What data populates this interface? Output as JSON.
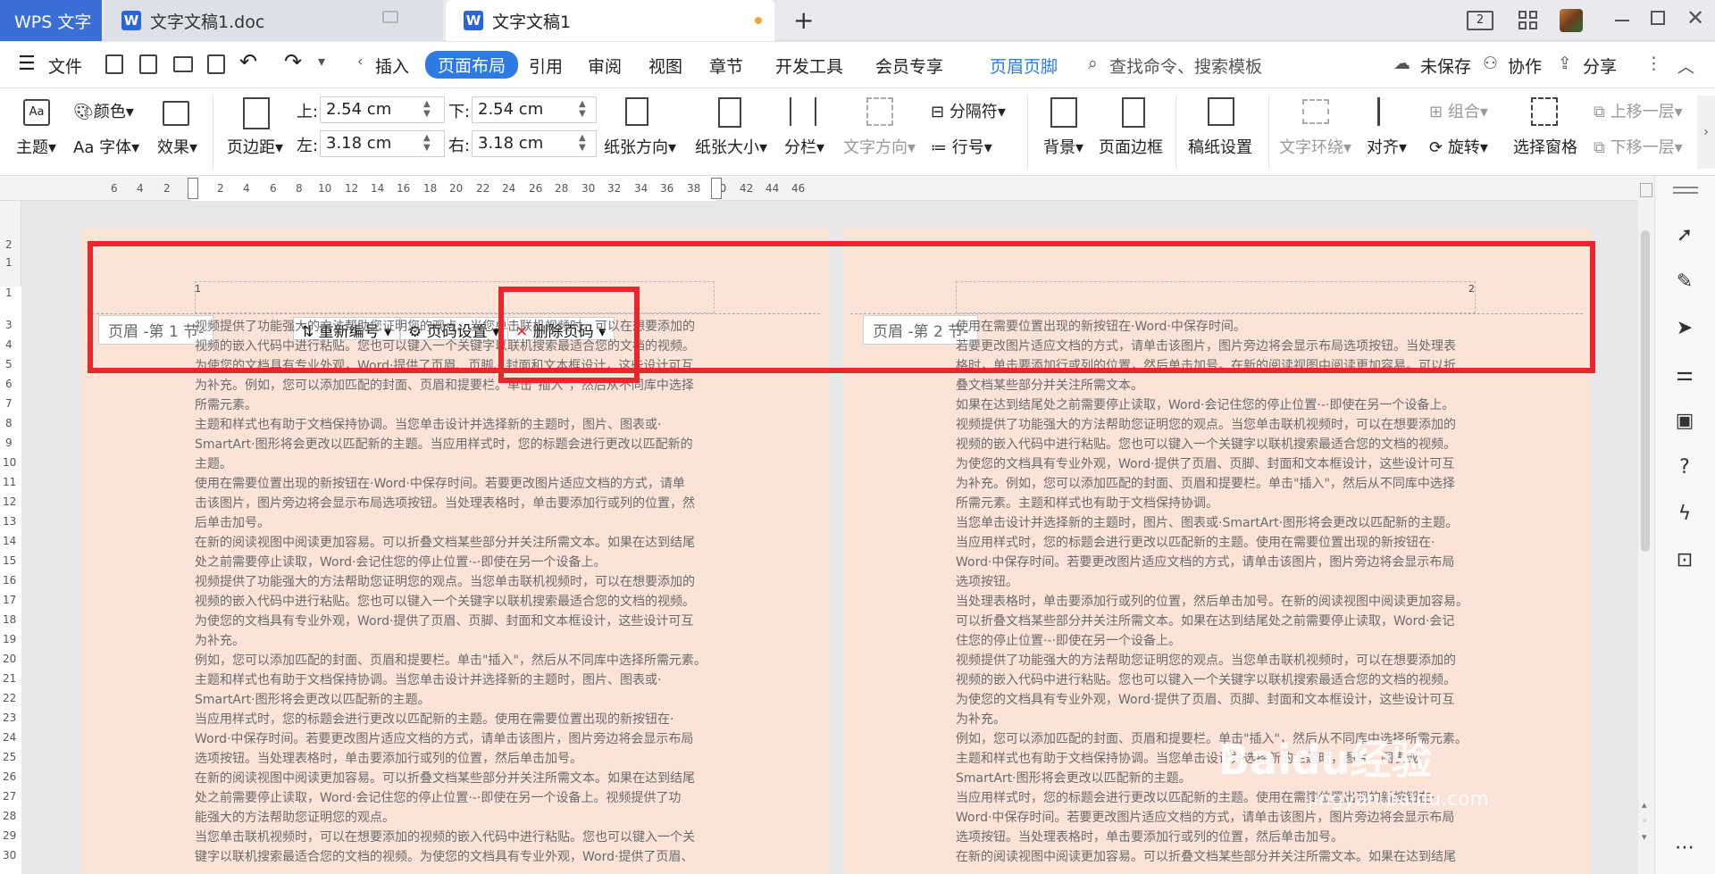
{
  "tabs": {
    "app": "WPS 文字",
    "doc1": "文字文稿1.doc",
    "doc2": "文字文稿1",
    "new_tab": "+",
    "badge": "2"
  },
  "menu": {
    "file": "文件",
    "items": [
      "插入",
      "页面布局",
      "引用",
      "审阅",
      "视图",
      "章节",
      "开发工具",
      "会员专享",
      "页眉页脚"
    ],
    "search": "查找命令、搜索模板",
    "unsaved": "未保存",
    "collab": "协作",
    "share": "分享"
  },
  "ribbon": {
    "theme": "主题",
    "color": "颜色",
    "font": "字体",
    "effect": "效果",
    "margin": "页边距",
    "top_label": "上:",
    "top_value": "2.54 cm",
    "bottom_label": "下:",
    "bottom_value": "2.54 cm",
    "left_label": "左:",
    "left_value": "3.18 cm",
    "right_label": "右:",
    "right_value": "3.18 cm",
    "orientation": "纸张方向",
    "size": "纸张大小",
    "columns": "分栏",
    "text_direction": "文字方向",
    "separator": "分隔符",
    "line_number": "行号",
    "background": "背景",
    "page_border": "页面边框",
    "manuscript": "稿纸设置",
    "text_wrap": "文字环绕",
    "align": "对齐",
    "group": "组合",
    "rotate": "旋转",
    "selection_pane": "选择窗格",
    "bring_forward": "上移一层",
    "send_backward": "下移一层"
  },
  "ruler": {
    "top": [
      "6",
      "4",
      "2",
      "2",
      "4",
      "6",
      "8",
      "10",
      "12",
      "14",
      "16",
      "18",
      "20",
      "22",
      "24",
      "26",
      "28",
      "30",
      "32",
      "34",
      "36",
      "38",
      "40",
      "42",
      "44",
      "46"
    ],
    "left": [
      "2",
      "1",
      "1",
      "3",
      "4",
      "5",
      "6",
      "7",
      "8",
      "9",
      "10",
      "11",
      "12",
      "13",
      "14",
      "15",
      "16",
      "17",
      "18",
      "19",
      "20",
      "21",
      "22",
      "23",
      "24",
      "25",
      "26",
      "27",
      "28",
      "29",
      "30"
    ]
  },
  "header": {
    "page1_label": "页眉 -第 1 节-",
    "page2_label": "页眉 -第 2 节-",
    "renumber": "重新编号",
    "page_num_settings": "页码设置",
    "delete_page_num": "删除页码",
    "page1_num": "1",
    "page2_num": "2"
  },
  "page1_lines": [
    "视频提供了功能强大的方法帮助您证明您的观点。当您单击联机视频时，可以在想要添加的",
    "视频的嵌入代码中进行粘贴。您也可以键入一个关键字以联机搜索最适合您的文档的视频。",
    "为使您的文档具有专业外观，Word·提供了页眉、页脚、封面和文本框设计，这些设计可互",
    "为补充。例如，您可以添加匹配的封面、页眉和提要栏。单击\"插入\"，然后从不同库中选择",
    "所需元素。",
    "主题和样式也有助于文档保持协调。当您单击设计并选择新的主题时，图片、图表或·",
    "SmartArt·图形将会更改以匹配新的主题。当应用样式时，您的标题会进行更改以匹配新的",
    "主题。",
    "使用在需要位置出现的新按钮在·Word·中保存时间。若要更改图片适应文档的方式，请单",
    "击该图片，图片旁边将会显示布局选项按钮。当处理表格时，单击要添加行或列的位置，然",
    "后单击加号。",
    "在新的阅读视图中阅读更加容易。可以折叠文档某些部分并关注所需文本。如果在达到结尾",
    "处之前需要停止读取，Word·会记住您的停止位置·-·即使在另一个设备上。",
    "视频提供了功能强大的方法帮助您证明您的观点。当您单击联机视频时，可以在想要添加的",
    "视频的嵌入代码中进行粘贴。您也可以键入一个关键字以联机搜索最适合您的文档的视频。",
    "为使您的文档具有专业外观，Word·提供了页眉、页脚、封面和文本框设计，这些设计可互",
    "为补充。",
    "例如，您可以添加匹配的封面、页眉和提要栏。单击\"插入\"，然后从不同库中选择所需元素。",
    "主题和样式也有助于文档保持协调。当您单击设计并选择新的主题时，图片、图表或·",
    "SmartArt·图形将会更改以匹配新的主题。",
    "当应用样式时，您的标题会进行更改以匹配新的主题。使用在需要位置出现的新按钮在·",
    "Word·中保存时间。若要更改图片适应文档的方式，请单击该图片，图片旁边将会显示布局",
    "选项按钮。当处理表格时，单击要添加行或列的位置，然后单击加号。",
    "在新的阅读视图中阅读更加容易。可以折叠文档某些部分并关注所需文本。如果在达到结尾",
    "处之前需要停止读取，Word·会记住您的停止位置·-·即使在另一个设备上。视频提供了功",
    "能强大的方法帮助您证明您的观点。",
    "当您单击联机视频时，可以在想要添加的视频的嵌入代码中进行粘贴。您也可以键入一个关",
    "键字以联机搜索最适合您的文档的视频。为使您的文档具有专业外观，Word·提供了页眉、"
  ],
  "page2_lines": [
    "使用在需要位置出现的新按钮在·Word·中保存时间。",
    "若要更改图片适应文档的方式，请单击该图片，图片旁边将会显示布局选项按钮。当处理表",
    "格时，单击要添加行或列的位置，然后单击加号。在新的阅读视图中阅读更加容易。可以折",
    "叠文档某些部分并关注所需文本。",
    "如果在达到结尾处之前需要停止读取，Word·会记住您的停止位置·-·即使在另一个设备上。",
    "视频提供了功能强大的方法帮助您证明您的观点。当您单击联机视频时，可以在想要添加的",
    "视频的嵌入代码中进行粘贴。您也可以键入一个关键字以联机搜索最适合您的文档的视频。",
    "为使您的文档具有专业外观，Word·提供了页眉、页脚、封面和文本框设计，这些设计可互",
    "为补充。例如，您可以添加匹配的封面、页眉和提要栏。单击\"插入\"，然后从不同库中选择",
    "所需元素。主题和样式也有助于文档保持协调。",
    "当您单击设计并选择新的主题时，图片、图表或·SmartArt·图形将会更改以匹配新的主题。",
    "当应用样式时，您的标题会进行更改以匹配新的主题。使用在需要位置出现的新按钮在·",
    "Word·中保存时间。若要更改图片适应文档的方式，请单击该图片，图片旁边将会显示布局",
    "选项按钮。",
    "当处理表格时，单击要添加行或列的位置，然后单击加号。在新的阅读视图中阅读更加容易。",
    "可以折叠文档某些部分并关注所需文本。如果在达到结尾处之前需要停止读取，Word·会记",
    "住您的停止位置·-·即使在另一个设备上。",
    "视频提供了功能强大的方法帮助您证明您的观点。当您单击联机视频时，可以在想要添加的",
    "视频的嵌入代码中进行粘贴。您也可以键入一个关键字以联机搜索最适合您的文档的视频。",
    "为使您的文档具有专业外观，Word·提供了页眉、页脚、封面和文本框设计，这些设计可互",
    "为补充。",
    "例如，您可以添加匹配的封面、页眉和提要栏。单击\"插入\"，然后从不同库中选择所需元素。",
    "主题和样式也有助于文档保持协调。当您单击设计并选择新的主题时，图片、图表或·",
    "SmartArt·图形将会更改以匹配新的主题。",
    "当应用样式时，您的标题会进行更改以匹配新的主题。使用在需要位置出现的新按钮在·",
    "Word·中保存时间。若要更改图片适应文档的方式，请单击该图片，图片旁边将会显示布局",
    "选项按钮。当处理表格时，单击要添加行或列的位置，然后单击加号。",
    "在新的阅读视图中阅读更加容易。可以折叠文档某些部分并关注所需文本。如果在达到结尾"
  ],
  "watermark": {
    "brand": "Baidu",
    "text": "经验",
    "url": "jingyan.baidu.com"
  },
  "colors": {
    "accent": "#2c7be5",
    "page": "#fbe3d8",
    "highlight": "#e8262b"
  }
}
